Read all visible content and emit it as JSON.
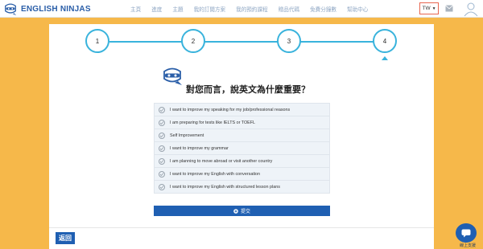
{
  "header": {
    "logo": {
      "text_main": "ENGLISH",
      "text_accent": "NINJAS"
    },
    "nav": [
      "主頁",
      "進度",
      "主題",
      "我的訂閱方案",
      "我的預約課程",
      "贈品代碼",
      "免費分鐘數",
      "幫助中心"
    ],
    "language": "TW"
  },
  "stepper": {
    "steps": [
      "1",
      "2",
      "3",
      "4"
    ],
    "active_step": 4
  },
  "question": "對您而言，說英文為什麼重要？",
  "options": [
    "I want to improve my speaking for my job/professional reasons",
    "I am preparing for tests like IELTS or TOEFL",
    "Self Improvement",
    "I want to improve my grammar",
    "I am planning to move abroad or visit another country",
    "I want to improve my English with conversation",
    "I want to improve my English with structured lesson plans"
  ],
  "submit_label": "提交",
  "back_label": "返回",
  "chat_label": "線上支援",
  "colors": {
    "background": "#f6b84a",
    "accent_teal": "#39b3dc",
    "primary_blue": "#1f5fb2",
    "language_border": "#e8654f"
  },
  "icons": {
    "logo": "ninja-logo-icon",
    "mail": "mail-icon",
    "avatar": "user-avatar-icon",
    "mascot": "ninja-mascot-icon",
    "option": "check-circle-icon",
    "submit": "plus-circle-icon",
    "chat": "chat-bubble-icon"
  }
}
